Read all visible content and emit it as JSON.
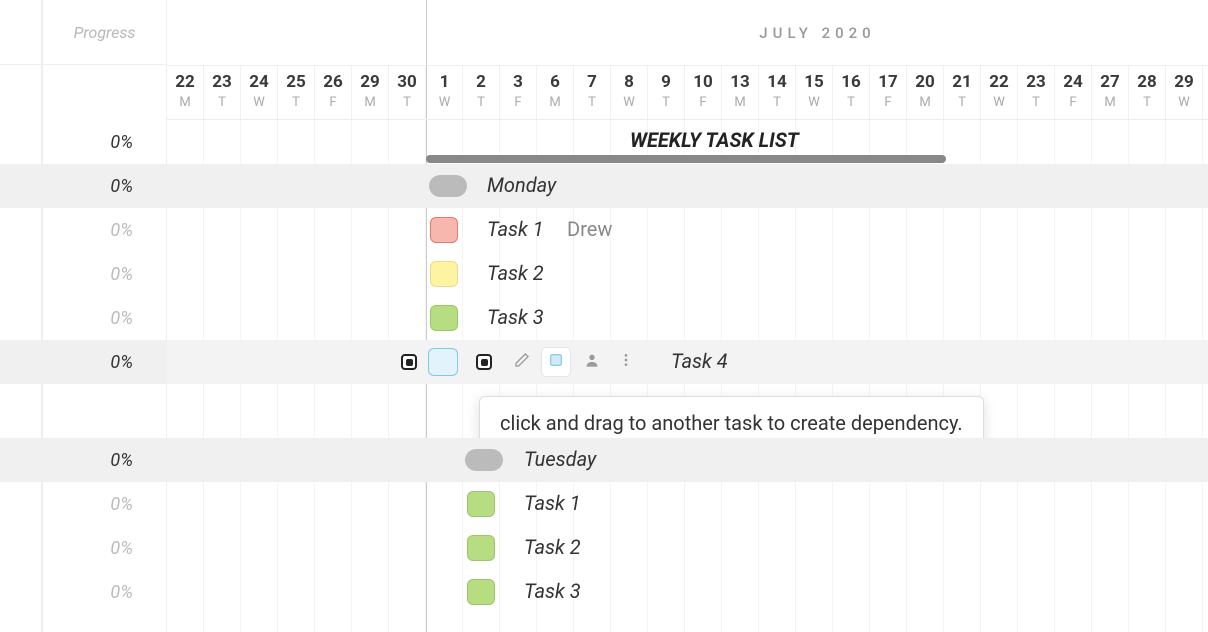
{
  "header": {
    "progress_label": "Progress",
    "month_label": "JULY 2020"
  },
  "dates": [
    {
      "num": "22",
      "dow": "M"
    },
    {
      "num": "23",
      "dow": "T"
    },
    {
      "num": "24",
      "dow": "W"
    },
    {
      "num": "25",
      "dow": "T"
    },
    {
      "num": "26",
      "dow": "F"
    },
    {
      "num": "29",
      "dow": "M"
    },
    {
      "num": "30",
      "dow": "T"
    },
    {
      "num": "1",
      "dow": "W",
      "month_start": true
    },
    {
      "num": "2",
      "dow": "T"
    },
    {
      "num": "3",
      "dow": "F"
    },
    {
      "num": "6",
      "dow": "M"
    },
    {
      "num": "7",
      "dow": "T"
    },
    {
      "num": "8",
      "dow": "W"
    },
    {
      "num": "9",
      "dow": "T"
    },
    {
      "num": "10",
      "dow": "F"
    },
    {
      "num": "13",
      "dow": "M"
    },
    {
      "num": "14",
      "dow": "T"
    },
    {
      "num": "15",
      "dow": "W"
    },
    {
      "num": "16",
      "dow": "T"
    },
    {
      "num": "17",
      "dow": "F"
    },
    {
      "num": "20",
      "dow": "M"
    },
    {
      "num": "21",
      "dow": "T"
    },
    {
      "num": "22",
      "dow": "W"
    },
    {
      "num": "23",
      "dow": "T"
    },
    {
      "num": "24",
      "dow": "F"
    },
    {
      "num": "27",
      "dow": "M"
    },
    {
      "num": "28",
      "dow": "T"
    },
    {
      "num": "29",
      "dow": "W"
    }
  ],
  "board_title": "WEEKLY TASK LIST",
  "rows": [
    {
      "progress": "0%",
      "type": "title"
    },
    {
      "progress": "0%",
      "type": "group",
      "label": "Monday",
      "highlight": true
    },
    {
      "progress": "0%",
      "type": "task",
      "label": "Task 1",
      "assignee": "Drew",
      "color": "red"
    },
    {
      "progress": "0%",
      "type": "task",
      "label": "Task 2",
      "color": "yellow"
    },
    {
      "progress": "0%",
      "type": "task",
      "label": "Task 3",
      "color": "green"
    },
    {
      "progress": "0%",
      "type": "task-selected",
      "label": "Task 4",
      "color": "blue"
    },
    {
      "type": "spacer"
    },
    {
      "progress": "0%",
      "type": "group",
      "label": "Tuesday",
      "highlight": true
    },
    {
      "progress": "0%",
      "type": "task",
      "label": "Task 1",
      "color": "green"
    },
    {
      "progress": "0%",
      "type": "task",
      "label": "Task 2",
      "color": "green"
    },
    {
      "progress": "0%",
      "type": "task",
      "label": "Task 3",
      "color": "green"
    }
  ],
  "tooltip": "click and drag to another task to create dependency.",
  "icons": {
    "edit": "edit-icon",
    "color": "color-swatch-icon",
    "assign": "person-icon",
    "more": "more-vertical-icon",
    "dependency": "dependency-handle-icon"
  }
}
